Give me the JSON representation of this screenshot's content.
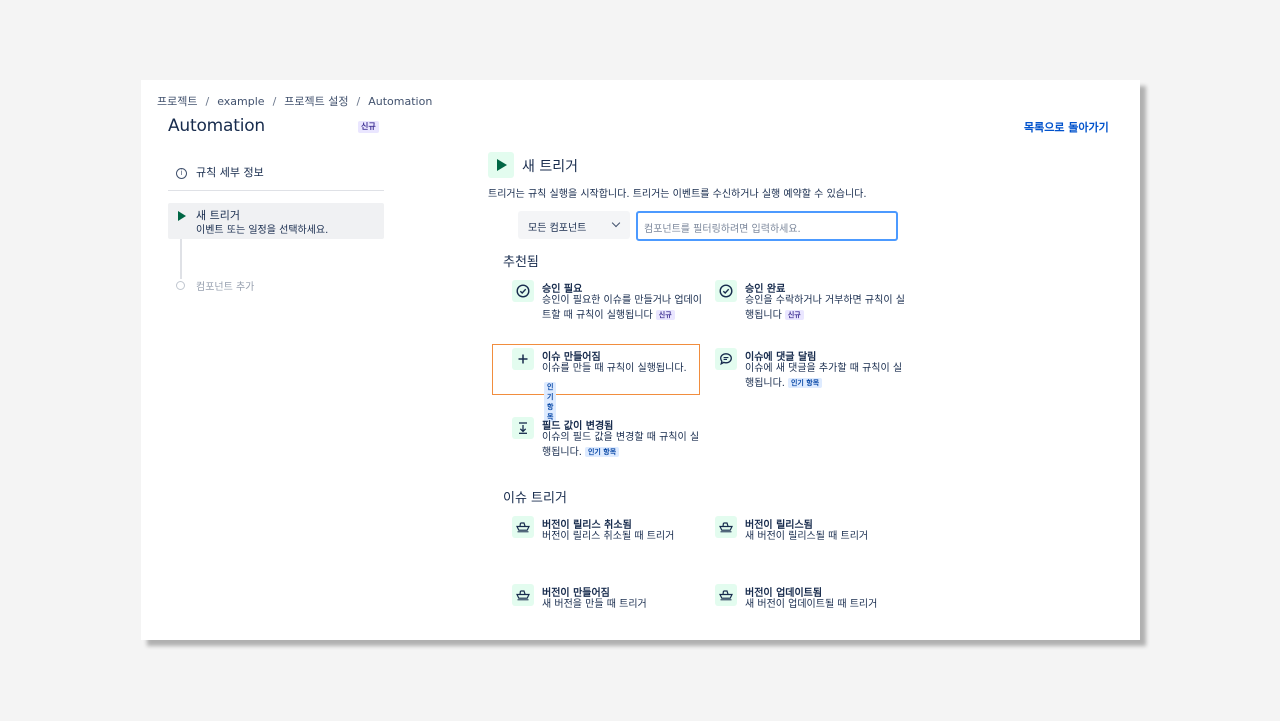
{
  "breadcrumb": [
    "프로젝트",
    "example",
    "프로젝트 설정",
    "Automation"
  ],
  "page": {
    "title": "Automation",
    "badge": "신규",
    "back_link": "목록으로 돌아가기"
  },
  "steps": {
    "details": "규칙 세부 정보",
    "active_title": "새 트리거",
    "active_desc": "이벤트 또는 일정을 선택하세요.",
    "add_component": "컴포넌트 추가"
  },
  "trigger": {
    "title": "새 트리거",
    "description": "트리거는 규칙 실행을 시작합니다. 트리거는 이벤트를 수신하거나 실행 예약할 수 있습니다.",
    "select_value": "모든 컴포넌트",
    "filter_placeholder": "컴포넌트를 필터링하려면 입력하세요."
  },
  "recommended": {
    "title": "추천됨",
    "items": [
      {
        "name": "승인 필요",
        "desc_lines": [
          "승인이 필요한 이슈를 만들거나 업데이",
          "트할 때 규칙이 실행됩니다"
        ],
        "badge": "신규",
        "icon": "check-circle-icon"
      },
      {
        "name": "승인 완료",
        "desc_lines": [
          "승인을 수락하거나 거부하면 규칙이 실",
          "행됩니다"
        ],
        "badge": "신규",
        "icon": "check-circle-icon"
      },
      {
        "name": "이슈 만들어짐",
        "desc_lines": [
          "이슈를 만들 때 규칙이 실행됩니다."
        ],
        "badge": "인기 항목",
        "icon": "plus-icon"
      },
      {
        "name": "이슈에 댓글 달림",
        "desc_lines": [
          "이슈에 새 댓글을 추가할 때 규칙이 실",
          "행됩니다."
        ],
        "badge": "인기 항목",
        "icon": "comment-icon"
      },
      {
        "name": "필드 값이 변경됨",
        "desc_lines": [
          "이슈의 필드 값을 변경할 때 규칙이 실",
          "행됩니다."
        ],
        "badge": "인기 항목",
        "icon": "field-change-icon"
      }
    ]
  },
  "issue_triggers": {
    "title": "이슈 트리거",
    "items": [
      {
        "name": "버전이 릴리스 취소됨",
        "desc": "버전이 릴리스 취소될 때 트리거",
        "icon": "ship-icon"
      },
      {
        "name": "버전이 릴리스됨",
        "desc": "새 버전이 릴리스될 때 트리거",
        "icon": "ship-icon"
      },
      {
        "name": "버전이 만들어짐",
        "desc": "새 버전을 만들 때 트리거",
        "icon": "ship-icon"
      },
      {
        "name": "버전이 업데이트됨",
        "desc": "새 버전이 업데이트될 때 트리거",
        "icon": "ship-icon"
      }
    ]
  },
  "colors": {
    "accent": "#0052cc",
    "trigger_green": "#006644",
    "icon_bg": "#e3fcef",
    "highlight": "#f18d3e",
    "focus": "#4c9aff"
  }
}
